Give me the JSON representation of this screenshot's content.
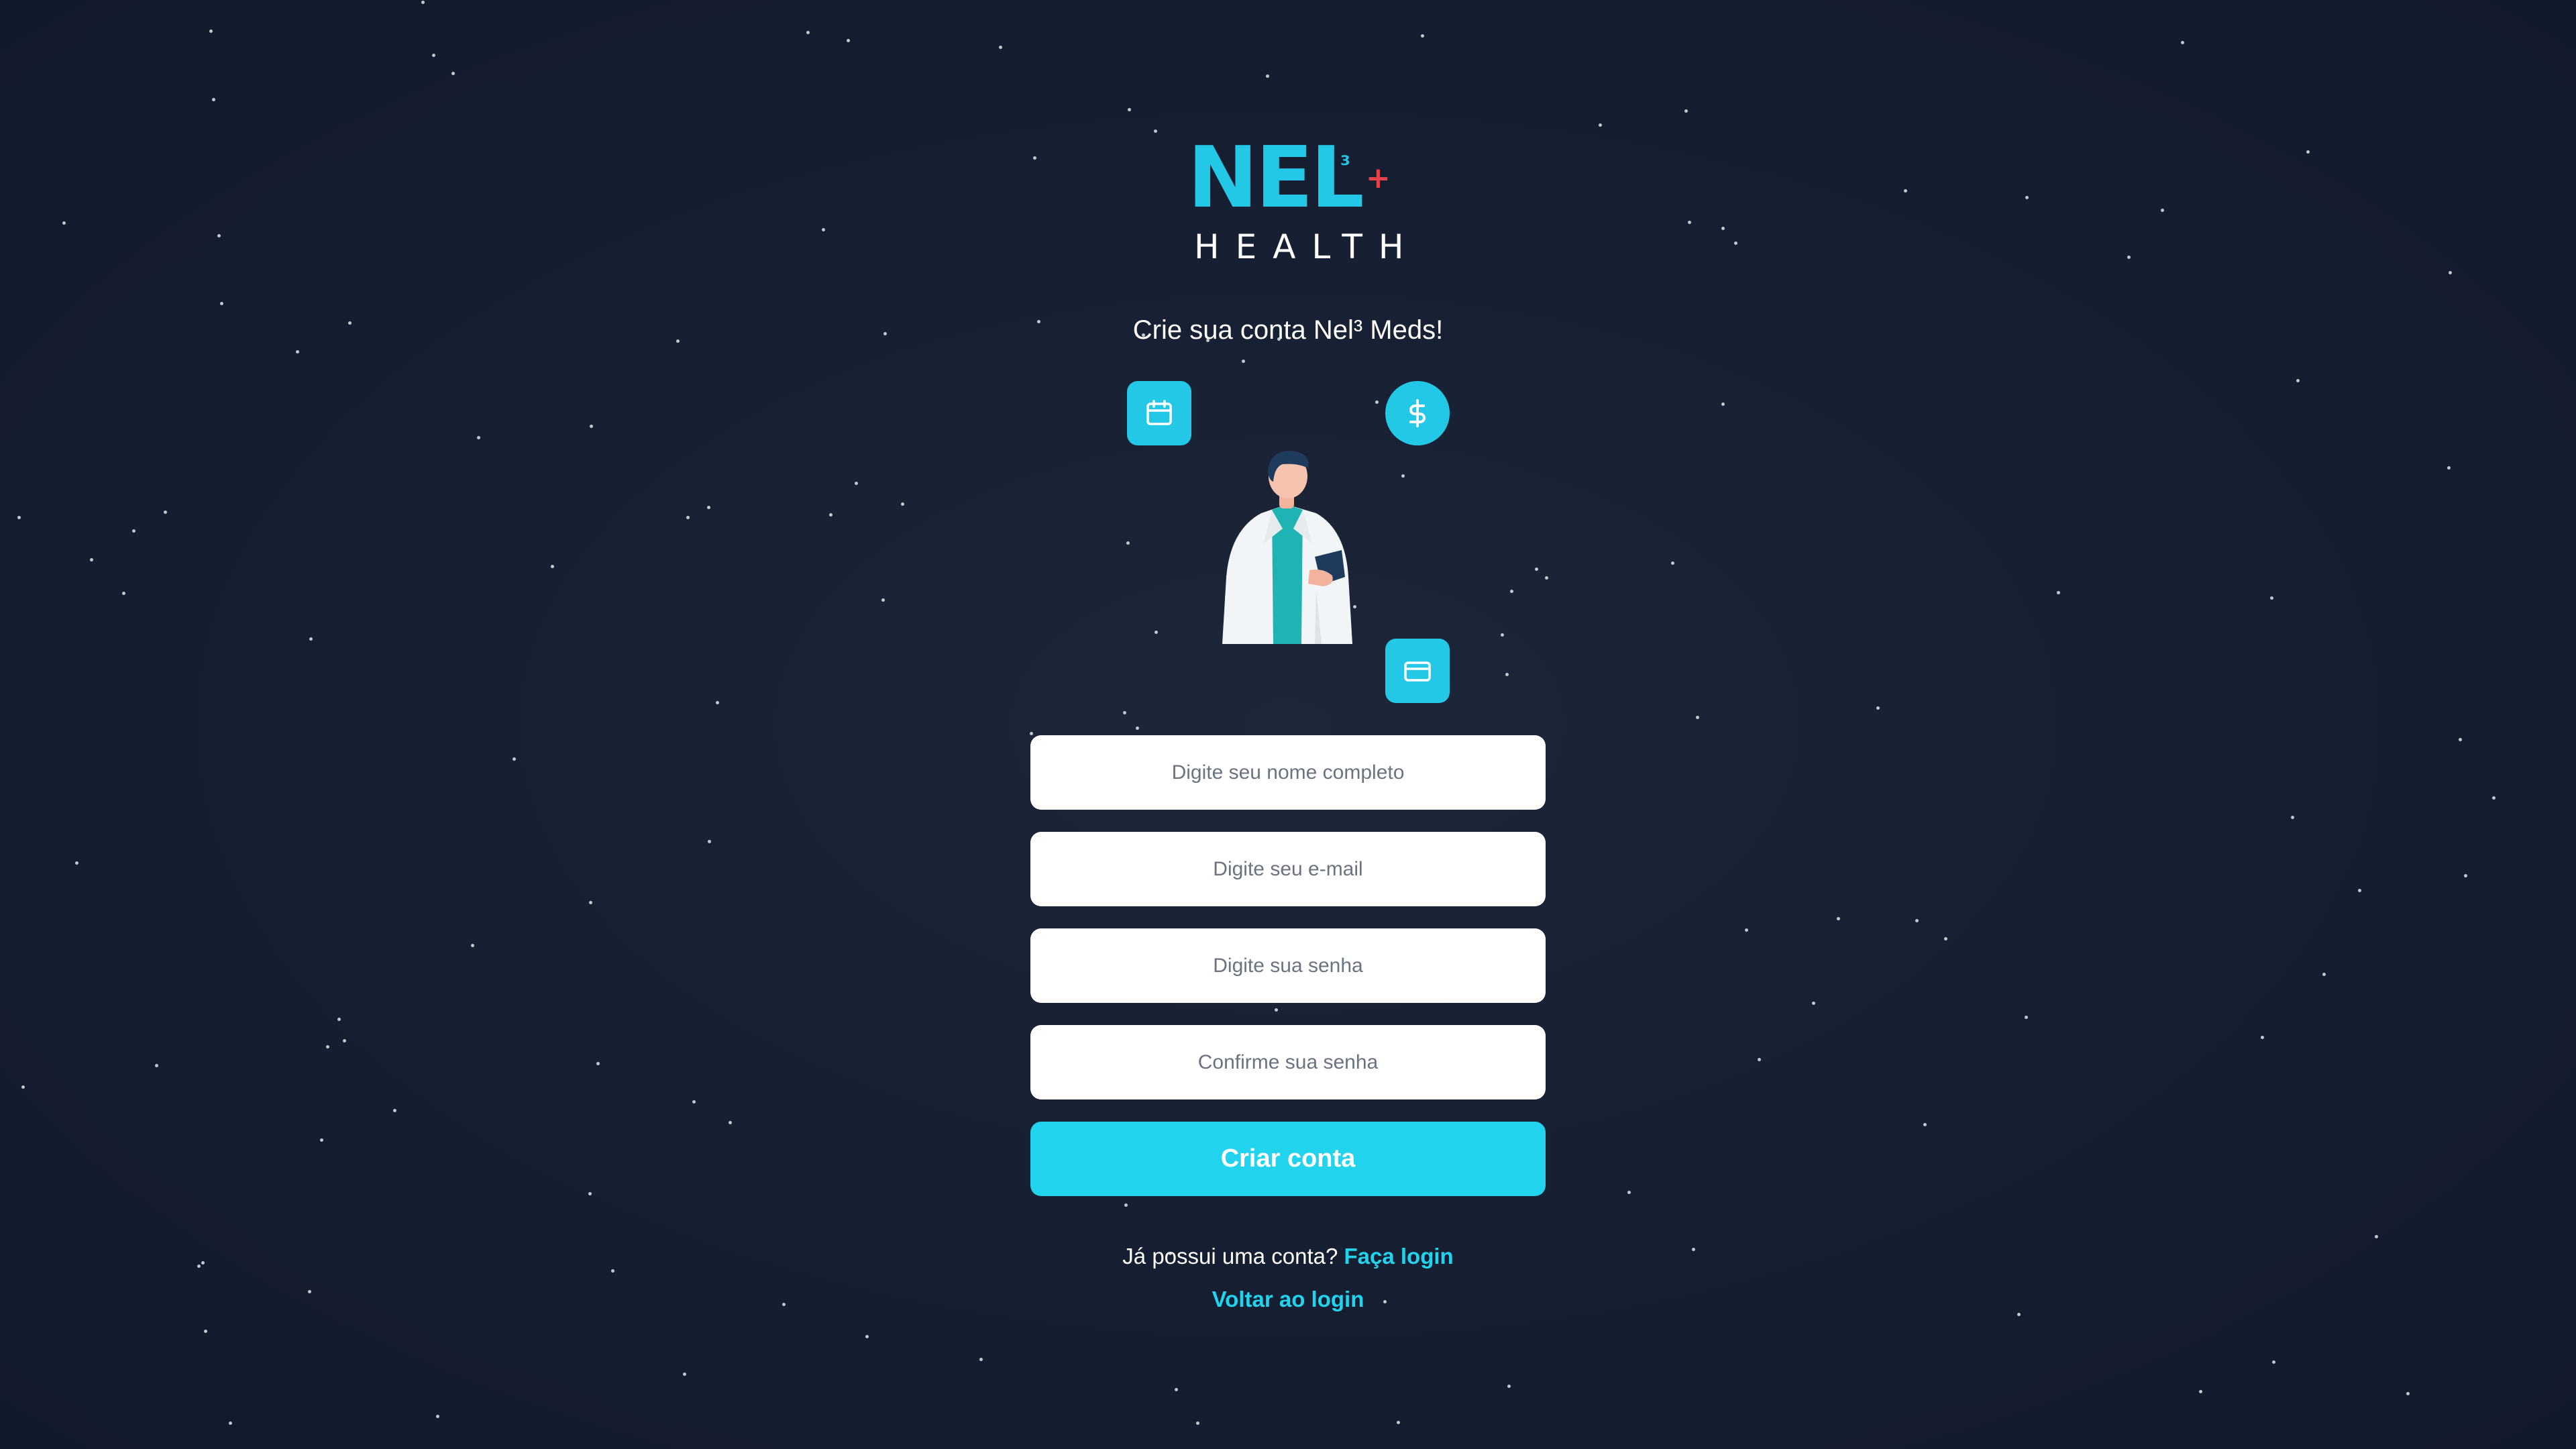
{
  "brand": {
    "name": "NEL",
    "superscript": "³",
    "plus": "+",
    "tagline": "HEALTH"
  },
  "subtitle": "Crie sua conta Nel³ Meds!",
  "illustration": {
    "icons": [
      "calendar-icon",
      "dollar-icon",
      "credit-card-icon"
    ]
  },
  "form": {
    "name_placeholder": "Digite seu nome completo",
    "email_placeholder": "Digite seu e-mail",
    "password_placeholder": "Digite sua senha",
    "confirm_placeholder": "Confirme sua senha",
    "submit_label": "Criar conta"
  },
  "footer": {
    "have_account": "Já possui uma conta?",
    "login_link": "Faça login",
    "back_link": "Voltar ao login"
  },
  "colors": {
    "accent": "#22d3ee",
    "brand_plus": "#e3414b",
    "background": "#172033"
  }
}
